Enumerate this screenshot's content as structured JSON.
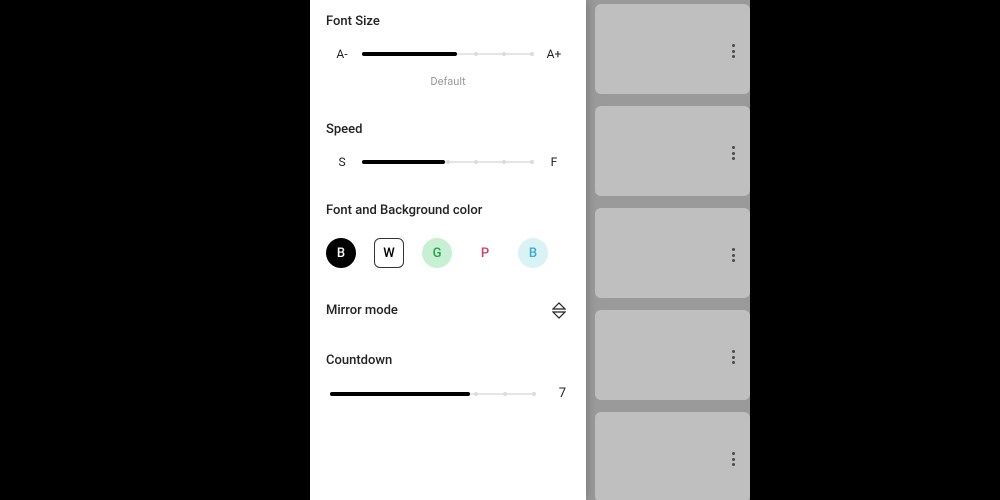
{
  "fontSize": {
    "title": "Font Size",
    "minLabel": "A-",
    "maxLabel": "A+",
    "subLabel": "Default",
    "fillPercent": 55
  },
  "speed": {
    "title": "Speed",
    "minLabel": "S",
    "maxLabel": "F",
    "fillPercent": 48
  },
  "colors": {
    "title": "Font and Background color",
    "options": [
      {
        "label": "B",
        "class": "sw-b"
      },
      {
        "label": "W",
        "class": "sw-w"
      },
      {
        "label": "G",
        "class": "sw-g"
      },
      {
        "label": "P",
        "class": "sw-p"
      },
      {
        "label": "B",
        "class": "sw-bl"
      }
    ]
  },
  "mirror": {
    "title": "Mirror mode"
  },
  "countdown": {
    "title": "Countdown",
    "value": "7",
    "fillPercent": 68
  }
}
